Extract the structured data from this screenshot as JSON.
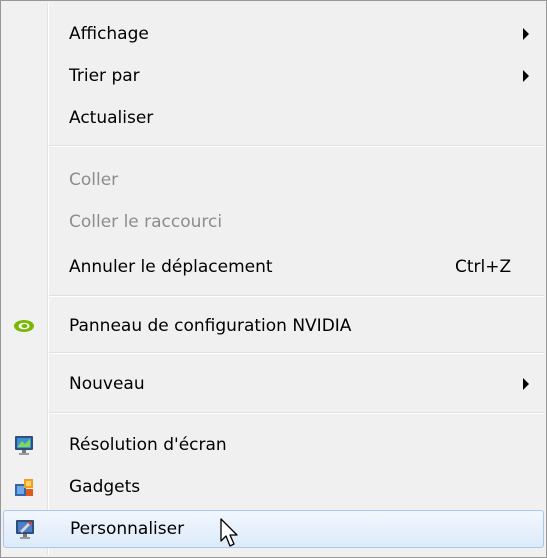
{
  "menu": {
    "view": {
      "label": "Affichage",
      "has_submenu": true
    },
    "sort_by": {
      "label": "Trier par",
      "has_submenu": true
    },
    "refresh": {
      "label": "Actualiser"
    },
    "paste": {
      "label": "Coller",
      "disabled": true
    },
    "paste_shortcut": {
      "label": "Coller le raccourci",
      "disabled": true
    },
    "undo_move": {
      "label": "Annuler le déplacement",
      "shortcut": "Ctrl+Z"
    },
    "nvidia_panel": {
      "label": "Panneau de configuration NVIDIA",
      "icon": "nvidia-icon"
    },
    "new": {
      "label": "Nouveau",
      "has_submenu": true
    },
    "screen_resolution": {
      "label": "Résolution d'écran",
      "icon": "display-icon"
    },
    "gadgets": {
      "label": "Gadgets",
      "icon": "gadgets-icon"
    },
    "personalize": {
      "label": "Personnaliser",
      "icon": "personalize-icon",
      "hovered": true
    }
  },
  "colors": {
    "menu_background": "#f0f0f0",
    "disabled_text": "#8d8d8d",
    "hover_border": "#a8c8ec",
    "nvidia_green": "#76b900"
  }
}
